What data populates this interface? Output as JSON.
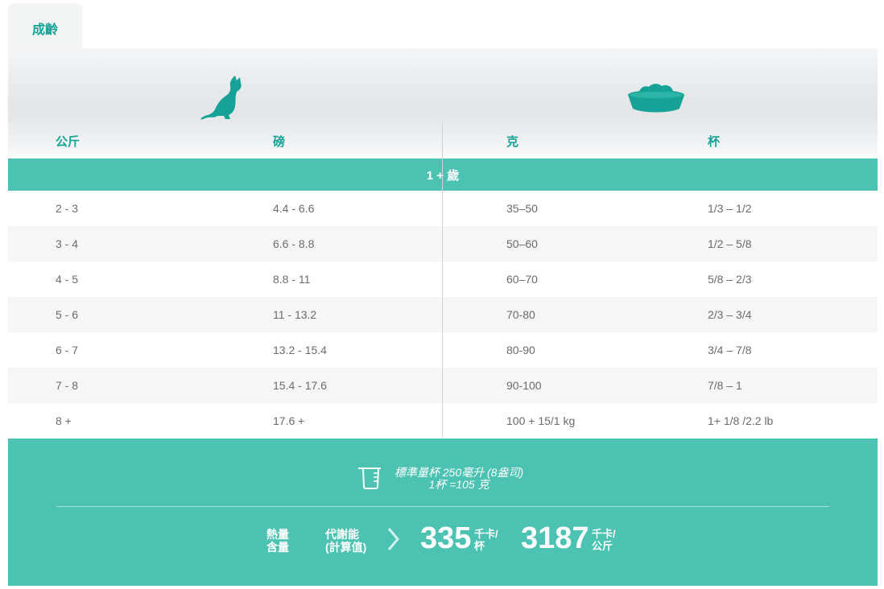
{
  "tab": {
    "label": "成齡"
  },
  "columns": {
    "kg": "公斤",
    "lb": "磅",
    "g": "克",
    "cup": "杯"
  },
  "age_band": "1 + 歲",
  "rows": [
    {
      "kg": "2 - 3",
      "lb": "4.4 - 6.6",
      "g": "35–50",
      "cup": "1/3 – 1/2"
    },
    {
      "kg": "3 - 4",
      "lb": "6.6 - 8.8",
      "g": "50–60",
      "cup": "1/2 – 5/8"
    },
    {
      "kg": "4 - 5",
      "lb": "8.8 - 11",
      "g": "60–70",
      "cup": "5/8 – 2/3"
    },
    {
      "kg": "5 - 6",
      "lb": "11 - 13.2",
      "g": "70-80",
      "cup": "2/3 – 3/4"
    },
    {
      "kg": "6 - 7",
      "lb": "13.2 - 15.4",
      "g": "80-90",
      "cup": "3/4 – 7/8"
    },
    {
      "kg": "7 - 8",
      "lb": "15.4 - 17.6",
      "g": "90-100",
      "cup": "7/8 – 1"
    },
    {
      "kg": "8 +",
      "lb": "17.6 +",
      "g": "100 + 15/1 kg",
      "cup": "1+ 1/8 /2.2 lb"
    }
  ],
  "footer": {
    "cup_note_line1": "標準量杯 250毫升 (8盎司)",
    "cup_note_line2": "1杯 =105 克",
    "energy_label_line1": "熱量",
    "energy_label_line2": "含量",
    "metabolic_label_line1": "代謝能",
    "metabolic_label_line2": "(計算值)",
    "kcal_per_cup": "335",
    "kcal_per_cup_unit_line1": "千卡/",
    "kcal_per_cup_unit_line2": "杯",
    "kcal_per_kg": "3187",
    "kcal_per_kg_unit_line1": "千卡/",
    "kcal_per_kg_unit_line2": "公斤"
  },
  "icons": {
    "cat": "cat-icon",
    "bowl": "food-bowl-icon",
    "cup": "measuring-cup-icon",
    "chevron": "chevron-right-icon"
  },
  "colors": {
    "accent": "#4cc2b3",
    "accent_dark": "#14a396"
  }
}
